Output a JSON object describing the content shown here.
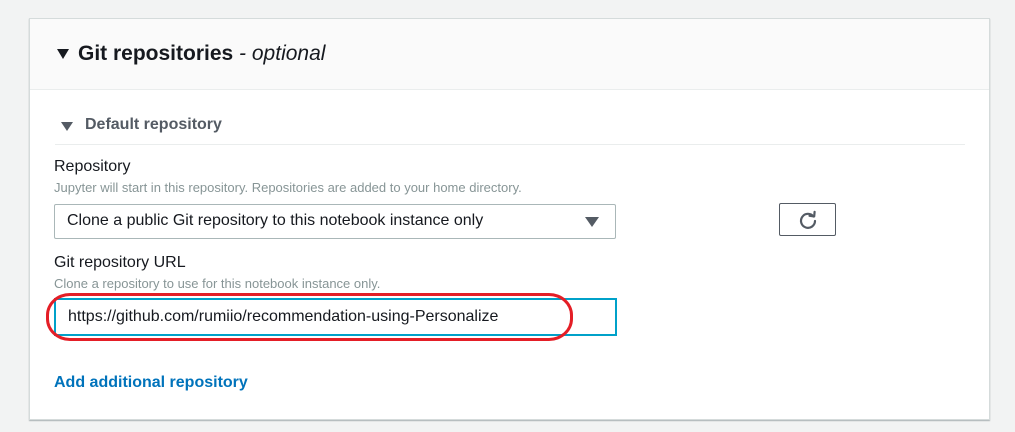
{
  "section": {
    "title": "Git repositories",
    "title_suffix": "- optional"
  },
  "default_repository": {
    "title": "Default repository",
    "repository": {
      "label": "Repository",
      "description": "Jupyter will start in this repository. Repositories are added to your home directory.",
      "selected_option": "Clone a public Git repository to this notebook instance only"
    },
    "git_url": {
      "label": "Git repository URL",
      "description": "Clone a repository to use for this notebook instance only.",
      "value": "https://github.com/rumiio/recommendation-using-Personalize"
    }
  },
  "add_repository_link": "Add additional repository",
  "icons": {
    "section_toggle": "caret-down-icon",
    "subsection_toggle": "caret-down-icon",
    "select_arrow": "caret-down-icon",
    "refresh": "refresh-icon"
  },
  "colors": {
    "link": "#0073bb",
    "input_focus": "#00a1c9",
    "annotation": "#e41e26",
    "panel_header_bg": "#fafafa",
    "page_bg": "#f2f3f3"
  }
}
